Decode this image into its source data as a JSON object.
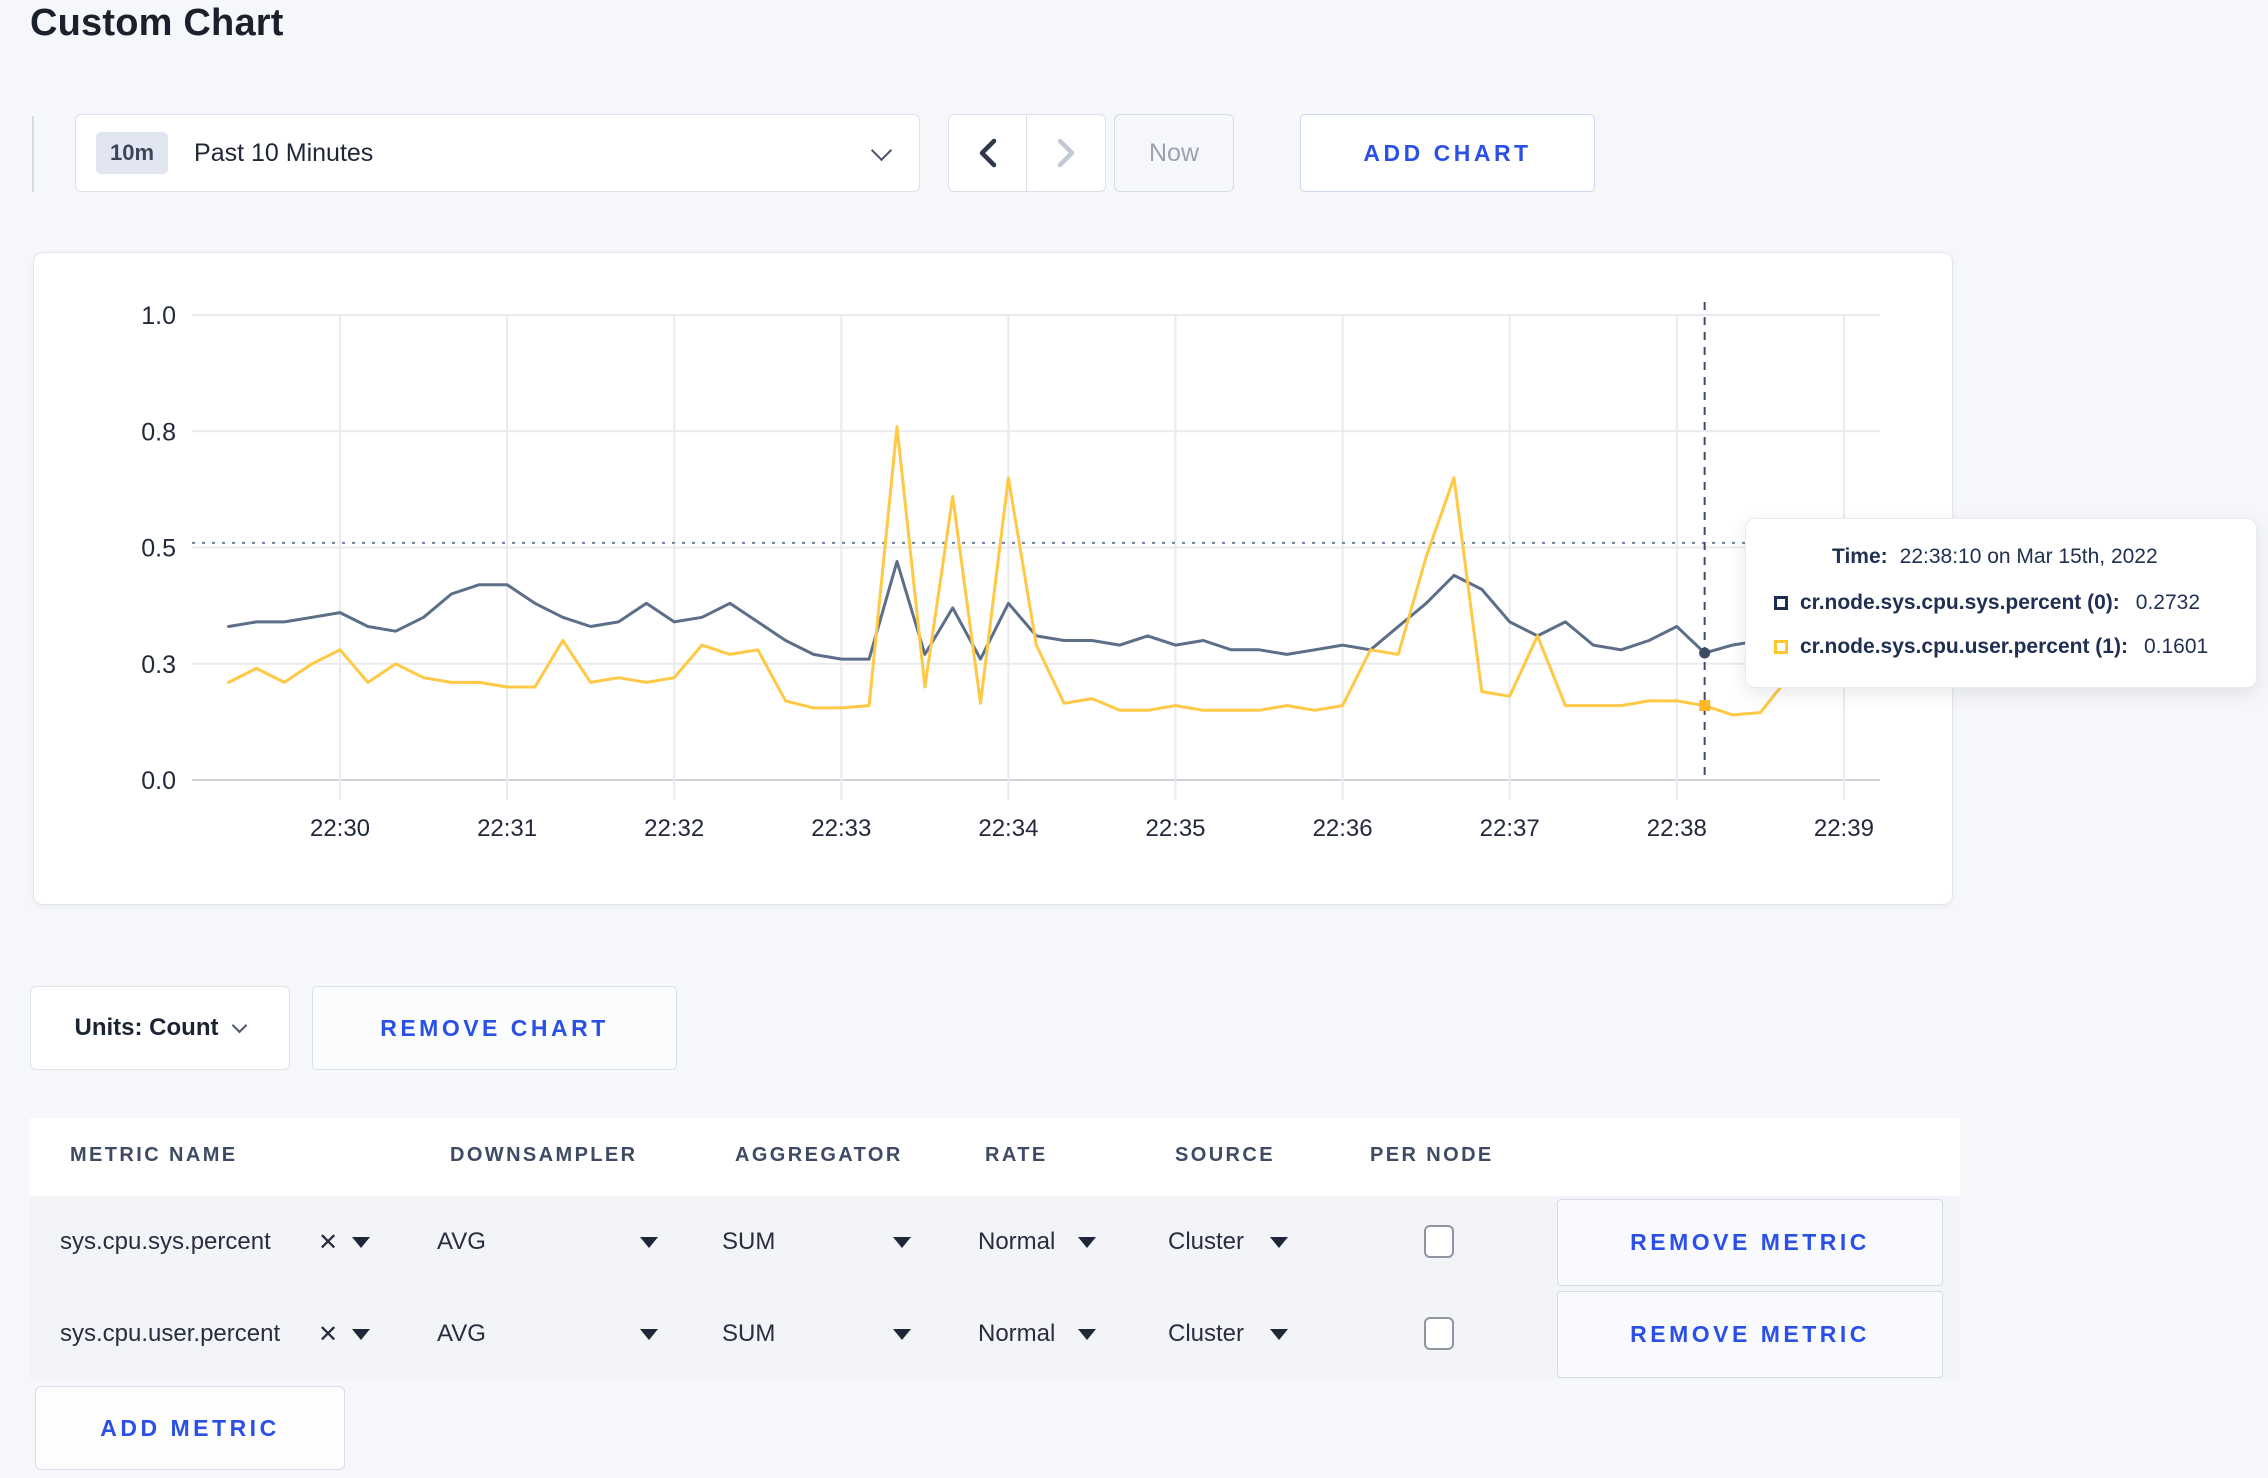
{
  "page": {
    "title": "Custom Chart",
    "accent_blue": "#2b50e8",
    "background": "#f6f7fa"
  },
  "toolbar": {
    "time_range": {
      "badge": "10m",
      "label": "Past 10 Minutes"
    },
    "now_label": "Now",
    "add_chart_label": "ADD CHART"
  },
  "chart_data": {
    "type": "line",
    "title": "",
    "xlabel": "",
    "ylabel": "",
    "ylim": [
      0,
      1
    ],
    "grid": true,
    "legend_position": "tooltip-only",
    "y_ticks": [
      {
        "label": "1.0",
        "value": 1.0
      },
      {
        "label": "0.8",
        "value": 0.75
      },
      {
        "label": "0.5",
        "value": 0.5
      },
      {
        "label": "0.3",
        "value": 0.25
      },
      {
        "label": "0.0",
        "value": 0.0
      }
    ],
    "x_ticks": [
      "22:30",
      "22:31",
      "22:32",
      "22:33",
      "22:34",
      "22:35",
      "22:36",
      "22:37",
      "22:38",
      "22:39"
    ],
    "x": [
      "22:29:20",
      "22:29:30",
      "22:29:40",
      "22:29:50",
      "22:30:00",
      "22:30:10",
      "22:30:20",
      "22:30:30",
      "22:30:40",
      "22:30:50",
      "22:31:00",
      "22:31:10",
      "22:31:20",
      "22:31:30",
      "22:31:40",
      "22:31:50",
      "22:32:00",
      "22:32:10",
      "22:32:20",
      "22:32:30",
      "22:32:40",
      "22:32:50",
      "22:33:00",
      "22:33:10",
      "22:33:20",
      "22:33:30",
      "22:33:40",
      "22:33:50",
      "22:34:00",
      "22:34:10",
      "22:34:20",
      "22:34:30",
      "22:34:40",
      "22:34:50",
      "22:35:00",
      "22:35:10",
      "22:35:20",
      "22:35:30",
      "22:35:40",
      "22:35:50",
      "22:36:00",
      "22:36:10",
      "22:36:20",
      "22:36:30",
      "22:36:40",
      "22:36:50",
      "22:37:00",
      "22:37:10",
      "22:37:20",
      "22:37:30",
      "22:37:40",
      "22:37:50",
      "22:38:00",
      "22:38:10",
      "22:38:20",
      "22:38:30",
      "22:38:40",
      "22:38:50",
      "22:39:00",
      "22:39:10"
    ],
    "series": [
      {
        "name": "cr.node.sys.cpu.sys.percent (0)",
        "color": "#5d6e89",
        "values": [
          0.33,
          0.34,
          0.34,
          0.35,
          0.36,
          0.33,
          0.32,
          0.35,
          0.4,
          0.42,
          0.42,
          0.38,
          0.35,
          0.33,
          0.34,
          0.38,
          0.34,
          0.35,
          0.38,
          0.34,
          0.3,
          0.27,
          0.26,
          0.26,
          0.47,
          0.27,
          0.37,
          0.26,
          0.38,
          0.31,
          0.3,
          0.3,
          0.29,
          0.31,
          0.29,
          0.3,
          0.28,
          0.28,
          0.27,
          0.28,
          0.29,
          0.28,
          0.33,
          0.38,
          0.44,
          0.41,
          0.34,
          0.31,
          0.34,
          0.29,
          0.28,
          0.3,
          0.33,
          0.2732,
          0.29,
          0.3,
          0.28,
          0.3,
          0.29,
          0.27
        ]
      },
      {
        "name": "cr.node.sys.cpu.user.percent (1)",
        "color": "#ffc845",
        "values": [
          0.21,
          0.24,
          0.21,
          0.25,
          0.28,
          0.21,
          0.25,
          0.22,
          0.21,
          0.21,
          0.2,
          0.2,
          0.3,
          0.21,
          0.22,
          0.21,
          0.22,
          0.29,
          0.27,
          0.28,
          0.17,
          0.155,
          0.155,
          0.16,
          0.76,
          0.2,
          0.61,
          0.165,
          0.65,
          0.29,
          0.165,
          0.175,
          0.15,
          0.15,
          0.16,
          0.15,
          0.15,
          0.15,
          0.16,
          0.15,
          0.16,
          0.28,
          0.27,
          0.48,
          0.65,
          0.19,
          0.18,
          0.31,
          0.16,
          0.16,
          0.16,
          0.17,
          0.17,
          0.1601,
          0.14,
          0.145,
          0.22,
          0.3,
          0.27,
          0.22
        ]
      }
    ],
    "crosshair": {
      "time": "22:38:10",
      "y_value": 0.51
    }
  },
  "tooltip": {
    "time_label": "Time:",
    "time_value": "22:38:10 on Mar 15th, 2022",
    "rows": [
      {
        "label": "cr.node.sys.cpu.sys.percent (0):",
        "value": "0.2732",
        "color": "#1c2f52"
      },
      {
        "label": "cr.node.sys.cpu.user.percent (1):",
        "value": "0.1601",
        "color": "#ffc72e"
      }
    ]
  },
  "chart_controls": {
    "units_label": "Units: Count",
    "remove_chart_label": "REMOVE CHART"
  },
  "metrics_table": {
    "headers": [
      "METRIC NAME",
      "DOWNSAMPLER",
      "AGGREGATOR",
      "RATE",
      "SOURCE",
      "PER NODE"
    ],
    "rows": [
      {
        "metric": "sys.cpu.sys.percent",
        "clear": "✕",
        "downsampler": "AVG",
        "aggregator": "SUM",
        "rate": "Normal",
        "source": "Cluster",
        "per_node_checked": false,
        "remove_label": "REMOVE METRIC"
      },
      {
        "metric": "sys.cpu.user.percent",
        "clear": "✕",
        "downsampler": "AVG",
        "aggregator": "SUM",
        "rate": "Normal",
        "source": "Cluster",
        "per_node_checked": false,
        "remove_label": "REMOVE METRIC"
      }
    ],
    "add_metric_label": "ADD METRIC"
  }
}
